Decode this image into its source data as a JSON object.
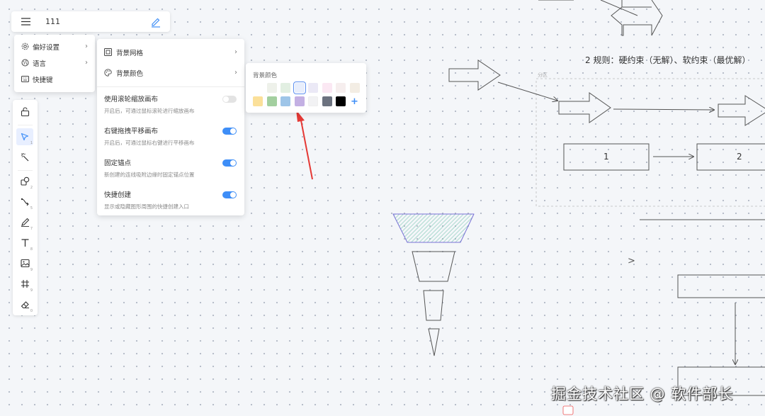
{
  "topbar": {
    "title": "111",
    "menu_icon": "hamburger-icon",
    "edit_icon": "pencil-icon"
  },
  "main_menu": {
    "items": [
      {
        "label": "偏好设置",
        "icon": "gear-icon",
        "has_submenu": true
      },
      {
        "label": "语言",
        "icon": "globe-icon",
        "has_submenu": true
      },
      {
        "label": "快捷键",
        "icon": "keyboard-icon",
        "has_submenu": false
      }
    ]
  },
  "preferences_menu": {
    "items": [
      {
        "label": "背景网格",
        "icon": "grid-icon"
      },
      {
        "label": "背景颜色",
        "icon": "palette-icon"
      }
    ],
    "toggles": [
      {
        "title": "使用滚轮缩放画布",
        "desc": "开启后，可通过鼠标滚轮进行缩放画布",
        "enabled": false
      },
      {
        "title": "右键拖拽平移画布",
        "desc": "开启后，可通过鼠标右键进行平移画布",
        "enabled": true
      },
      {
        "title": "固定锚点",
        "desc": "新创建的连线吸附边缘时固定锚点位置",
        "enabled": true
      },
      {
        "title": "快捷创建",
        "desc": "显示或隐藏图形周围的快捷创建入口",
        "enabled": true
      }
    ]
  },
  "color_panel": {
    "title": "背景颜色",
    "row1": [
      "",
      "#eef1ea",
      "#e2efe2",
      "#e8eefc",
      "#ebe9f6",
      "#fbe8f3",
      "#f6eeee",
      "#f3ede4"
    ],
    "row2": [
      "#fbe09a",
      "#a3cf9f",
      "#9ec5e8",
      "#c3b0e3",
      "#f2f2f4",
      "#6c727f",
      "#000000"
    ],
    "selected_index": 3,
    "add_label": "+"
  },
  "toolbar": {
    "tools": [
      {
        "icon": "lock-icon",
        "num": ""
      },
      {
        "icon": "pointer-icon",
        "num": "1"
      },
      {
        "icon": "magic-wand-icon",
        "num": ""
      },
      {
        "icon": "shapes-icon",
        "num": "2"
      },
      {
        "icon": "connector-icon",
        "num": "5"
      },
      {
        "icon": "pen-icon",
        "num": "7"
      },
      {
        "icon": "text-icon",
        "num": "8"
      },
      {
        "icon": "image-icon",
        "num": "9"
      },
      {
        "icon": "frame-icon",
        "num": "9"
      },
      {
        "icon": "eraser-icon",
        "num": "0"
      }
    ]
  },
  "canvas": {
    "rule_text": "2 规则：硬约束（无解）、软约束（最优解）",
    "group_label": "分区",
    "box1_label": "1",
    "box2_label": "2",
    "chevron": ">"
  },
  "watermark": "掘金技术社区 @ 软件部长",
  "colors": {
    "accent": "#3e8ef7",
    "annotation_arrow": "#e53935"
  }
}
